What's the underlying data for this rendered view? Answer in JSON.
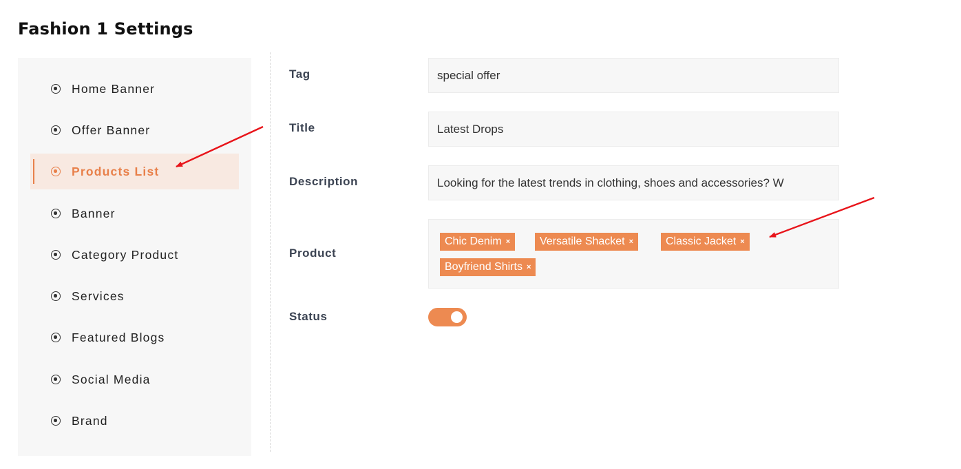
{
  "page": {
    "title": "Fashion 1 Settings"
  },
  "sidebar": {
    "items": [
      {
        "label": "Home Banner"
      },
      {
        "label": "Offer Banner"
      },
      {
        "label": "Products List",
        "active": true
      },
      {
        "label": "Banner"
      },
      {
        "label": "Category Product"
      },
      {
        "label": "Services"
      },
      {
        "label": "Featured Blogs"
      },
      {
        "label": "Social Media"
      },
      {
        "label": "Brand"
      }
    ]
  },
  "form": {
    "tag": {
      "label": "Tag",
      "value": "special offer"
    },
    "title": {
      "label": "Title",
      "value": "Latest Drops"
    },
    "description": {
      "label": "Description",
      "value": "Looking for the latest trends in clothing, shoes and accessories? W"
    },
    "product": {
      "label": "Product",
      "tags": [
        "Chic Denim",
        "Versatile Shacket",
        "Classic Jacket",
        "Boyfriend Shirts"
      ],
      "remove_glyph": "×"
    },
    "status": {
      "label": "Status",
      "on": true
    }
  },
  "colors": {
    "accent": "#ed8a51",
    "active_bg": "#f8e9e1",
    "annotation_arrow": "#e8141a"
  }
}
